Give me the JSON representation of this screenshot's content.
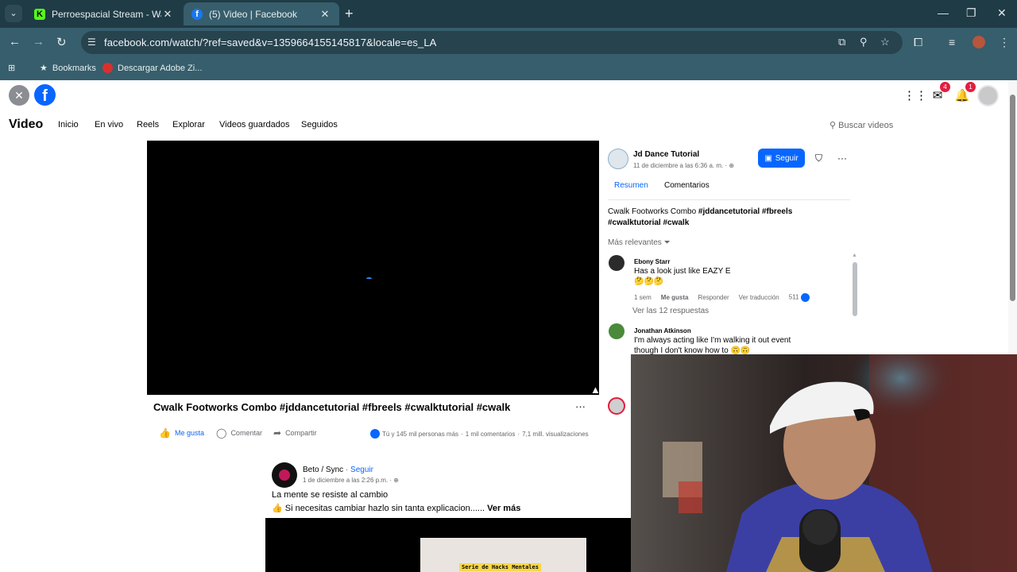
{
  "browser": {
    "tabs": [
      {
        "title": "Perroespacial Stream - Watch Li",
        "favicon_color": "#53fc18",
        "active": false
      },
      {
        "title": "(5) Video | Facebook",
        "favicon_color": "#1877f2",
        "active": true
      }
    ],
    "url": "facebook.com/watch/?ref=saved&v=1359664155145817&locale=es_LA",
    "bookmarks": [
      {
        "label": "Bookmarks",
        "icon": "star-icon"
      },
      {
        "label": "Descargar Adobe Zi...",
        "icon": "adobe-icon"
      }
    ]
  },
  "fb": {
    "header": {
      "messenger_badge": "4",
      "notifications_badge": "1"
    },
    "page_title": "Video",
    "nav": [
      "Inicio",
      "En vivo",
      "Reels",
      "Explorar",
      "Videos guardados",
      "Seguidos"
    ],
    "search_placeholder": "Buscar videos",
    "video": {
      "title": "Cwalk Footworks Combo #jddancetutorial #fbreels #cwalktutorial #cwalk",
      "more": "···",
      "actions": {
        "like": "Me gusta",
        "comment": "Comentar",
        "share": "Compartir"
      },
      "reactions": "Tú y 145 mil personas más",
      "comments": "1 mil comentarios",
      "views": "7,1 mill. visualizaciones"
    },
    "next_post": {
      "author": "Beto / Sync",
      "follow": "Seguir",
      "separator": "·",
      "date": "1 de diciembre a las 2:26 p.m. ·",
      "headline": "La mente se resiste al cambio",
      "body_emoji": "👍",
      "body": "Si necesitas cambiar hazlo sin tanta explicacion......",
      "see_more": "Ver más",
      "image_caption": "Serie de Hacks Mentales"
    },
    "panel": {
      "page_name": "Jd Dance Tutorial",
      "date": "11 de diciembre a las 6:36 a. m. ·",
      "follow_button": "Seguir",
      "tabs": [
        "Resumen",
        "Comentarios"
      ],
      "caption_plain": "Cwalk Footworks Combo ",
      "caption_tags": "#jddancetutorial #fbreels #cwalktutorial #cwalk",
      "sort": "Más relevantes",
      "comments": [
        {
          "name": "Ebony Starr",
          "text": "Has a look just like EAZY E",
          "emoji": "🤔🤔🤔",
          "time": "1 sem",
          "like": "Me gusta",
          "reply": "Responder",
          "translate": "Ver traducción",
          "reactions": "511"
        },
        {
          "name": "Jonathan Atkinson",
          "text_line1": "I'm always acting like I'm walking it out event",
          "text_line2": "though I don't know how to",
          "emoji": "🙃🙃"
        }
      ],
      "replies": "Ver las 12 respuestas"
    }
  }
}
